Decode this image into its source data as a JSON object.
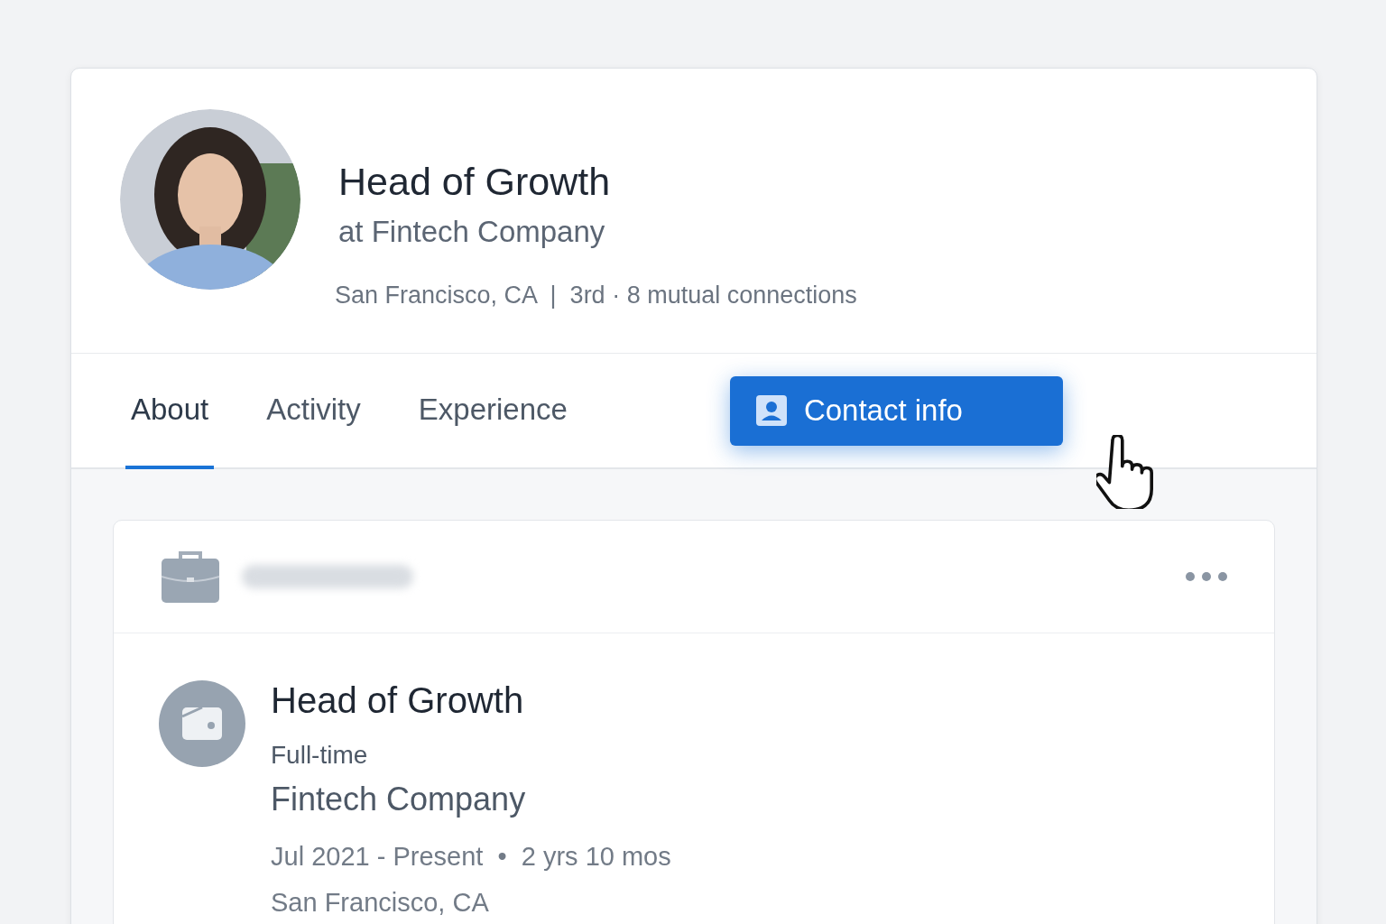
{
  "profile": {
    "title": "Head of Growth",
    "subtitle": "at Fintech Company",
    "meta": "San Francisco, CA  |  3rd · 8 mutual connections"
  },
  "tabs": [
    {
      "label": "About",
      "selected": true
    },
    {
      "label": "Activity",
      "selected": false
    },
    {
      "label": "Experience",
      "selected": false
    }
  ],
  "contact_button": {
    "label": "Contact info"
  },
  "experience": [
    {
      "title": "Head of Growth",
      "employment_type": "Full-time",
      "company": "Fintech Company",
      "dates": "Jul 2021 - Present  •  2 yrs 10 mos",
      "location": "San Francisco, CA"
    }
  ]
}
